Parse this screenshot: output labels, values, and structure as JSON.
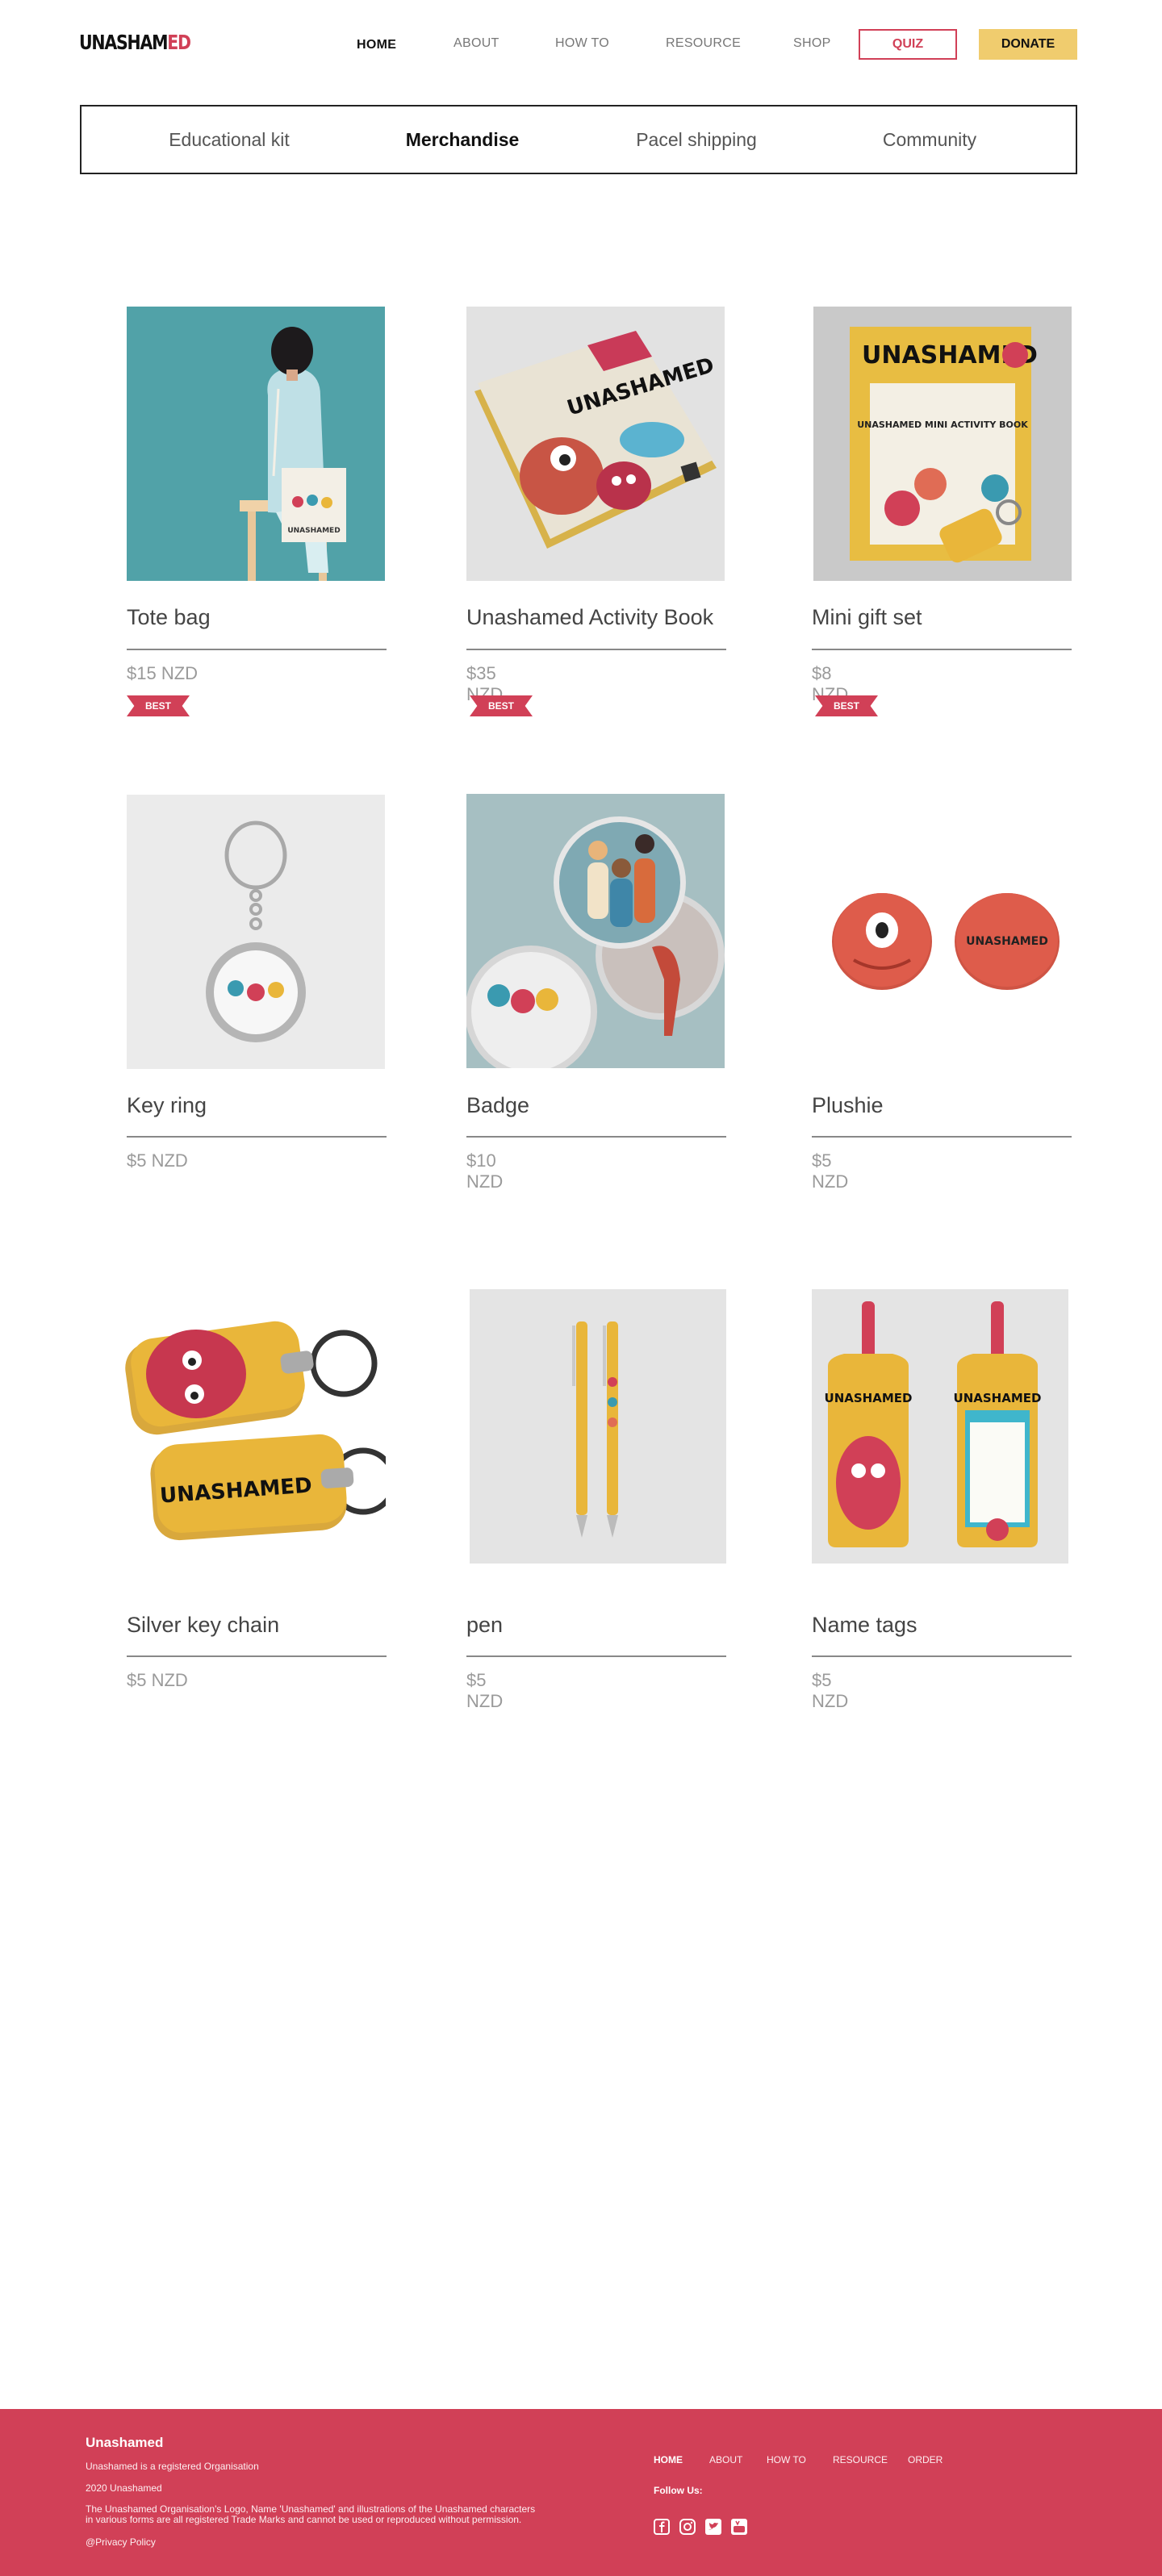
{
  "brand": {
    "name_part1": "UNASHAM",
    "name_part2": "ED",
    "accent": "#d14057",
    "yellow": "#f0cc6e"
  },
  "nav": {
    "items": [
      "HOME",
      "ABOUT",
      "HOW TO",
      "RESOURCE",
      "SHOP"
    ],
    "quiz": "QUIZ",
    "donate": "DONATE"
  },
  "tabs": [
    "Educational kit",
    "Merchandise",
    "Pacel shipping",
    "Community"
  ],
  "tabs_active": "Merchandise",
  "products": [
    {
      "title": "Tote bag",
      "price": "$15 NZD",
      "badge": "BEST",
      "image_label": "UNASHAMED"
    },
    {
      "title": "Unashamed Activity Book",
      "price": "$35 NZD",
      "badge": "BEST",
      "image_label": "UNASHAMED"
    },
    {
      "title": "Mini gift set",
      "price": "$8 NZD",
      "badge": "BEST",
      "image_label": "UNASHAMED",
      "image_sublabel": "UNASHAMED MINI ACTIVITY BOOK"
    },
    {
      "title": "Key ring",
      "price": "$5 NZD"
    },
    {
      "title": "Badge",
      "price": "$10 NZD"
    },
    {
      "title": "Plushie",
      "price": "$5 NZD",
      "image_label": "UNASHAMED"
    },
    {
      "title": "Silver key chain",
      "price": "$5 NZD",
      "image_label": "UNASHAMED"
    },
    {
      "title": "pen",
      "price": "$5 NZD"
    },
    {
      "title": "Name tags",
      "price": "$5 NZD",
      "image_label": "UNASHAMED"
    }
  ],
  "footer": {
    "title": "Unashamed",
    "line1": "Unashamed is a registered Organisation",
    "line2": "2020 Unashamed",
    "line3a": "The Unashamed Organisation's Logo, Name 'Unashamed' and illustrations of the Unashamed characters",
    "line3b": "in various forms are all registered Trade Marks and cannot be used or reproduced without permission.",
    "privacy": "@Privacy Policy",
    "nav": [
      "HOME",
      "ABOUT",
      "HOW TO",
      "RESOURCE",
      "ORDER"
    ],
    "follow": "Follow Us:",
    "social": [
      "facebook-icon",
      "instagram-icon",
      "twitter-icon",
      "youtube-icon"
    ]
  }
}
